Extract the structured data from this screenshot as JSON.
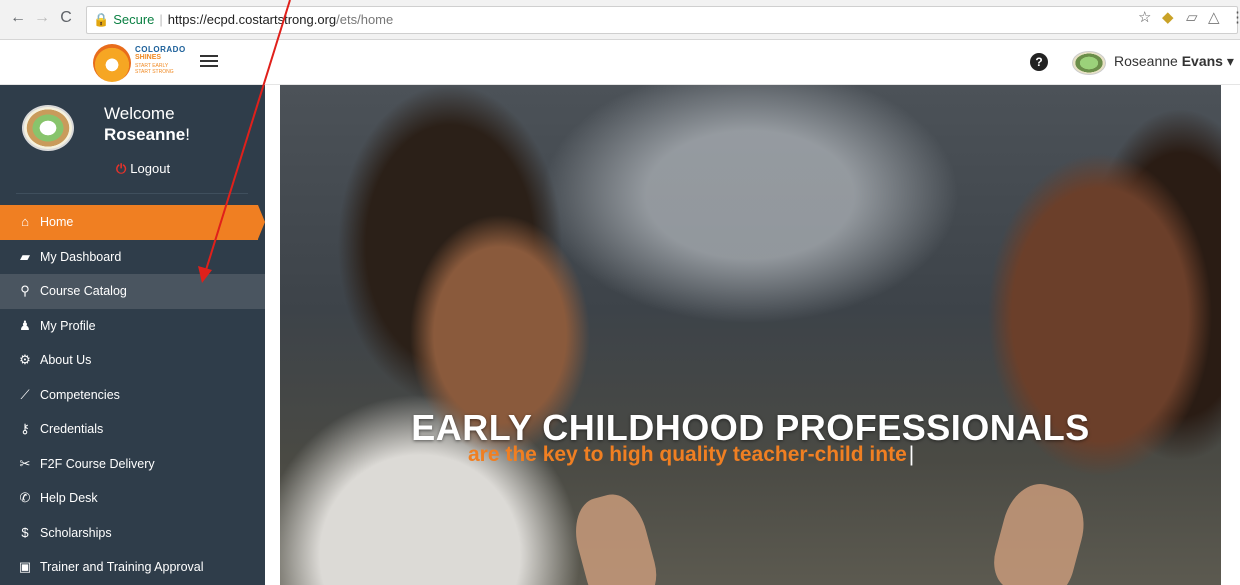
{
  "browser": {
    "secure_label": "Secure",
    "url_host": "https://ecpd.costartstrong.org",
    "url_path": "/ets/home"
  },
  "header": {
    "logo_line1": "COLORADO",
    "logo_line2": "SHINES",
    "logo_line3": "START EARLY START STRONG",
    "user_first": "Roseanne",
    "user_last": "Evans"
  },
  "sidebar": {
    "welcome": "Welcome",
    "user_name": "Roseanne",
    "user_exclaim": "!",
    "logout": "Logout",
    "items": [
      {
        "label": "Home",
        "icon": "home-icon"
      },
      {
        "label": "My Dashboard",
        "icon": "book-icon"
      },
      {
        "label": "Course Catalog",
        "icon": "search-icon"
      },
      {
        "label": "My Profile",
        "icon": "user-icon"
      },
      {
        "label": "About Us",
        "icon": "gear-icon"
      },
      {
        "label": "Competencies",
        "icon": "chart-line-icon"
      },
      {
        "label": "Credentials",
        "icon": "key-icon"
      },
      {
        "label": "F2F Course Delivery",
        "icon": "scissors-icon"
      },
      {
        "label": "Help Desk",
        "icon": "phone-icon"
      },
      {
        "label": "Scholarships",
        "icon": "dollar-icon"
      },
      {
        "label": "Trainer and Training Approval",
        "icon": "approval-icon"
      }
    ],
    "active_item": "Home",
    "highlighted_item": "Course Catalog"
  },
  "hero": {
    "title": "EARLY CHILDHOOD PROFESSIONALS",
    "subtitle": "are the key to high quality teacher-child inte"
  },
  "colors": {
    "sidebar_bg": "#2f3d4a",
    "accent_orange": "#f07f22",
    "annotation_red": "#e0201b"
  }
}
